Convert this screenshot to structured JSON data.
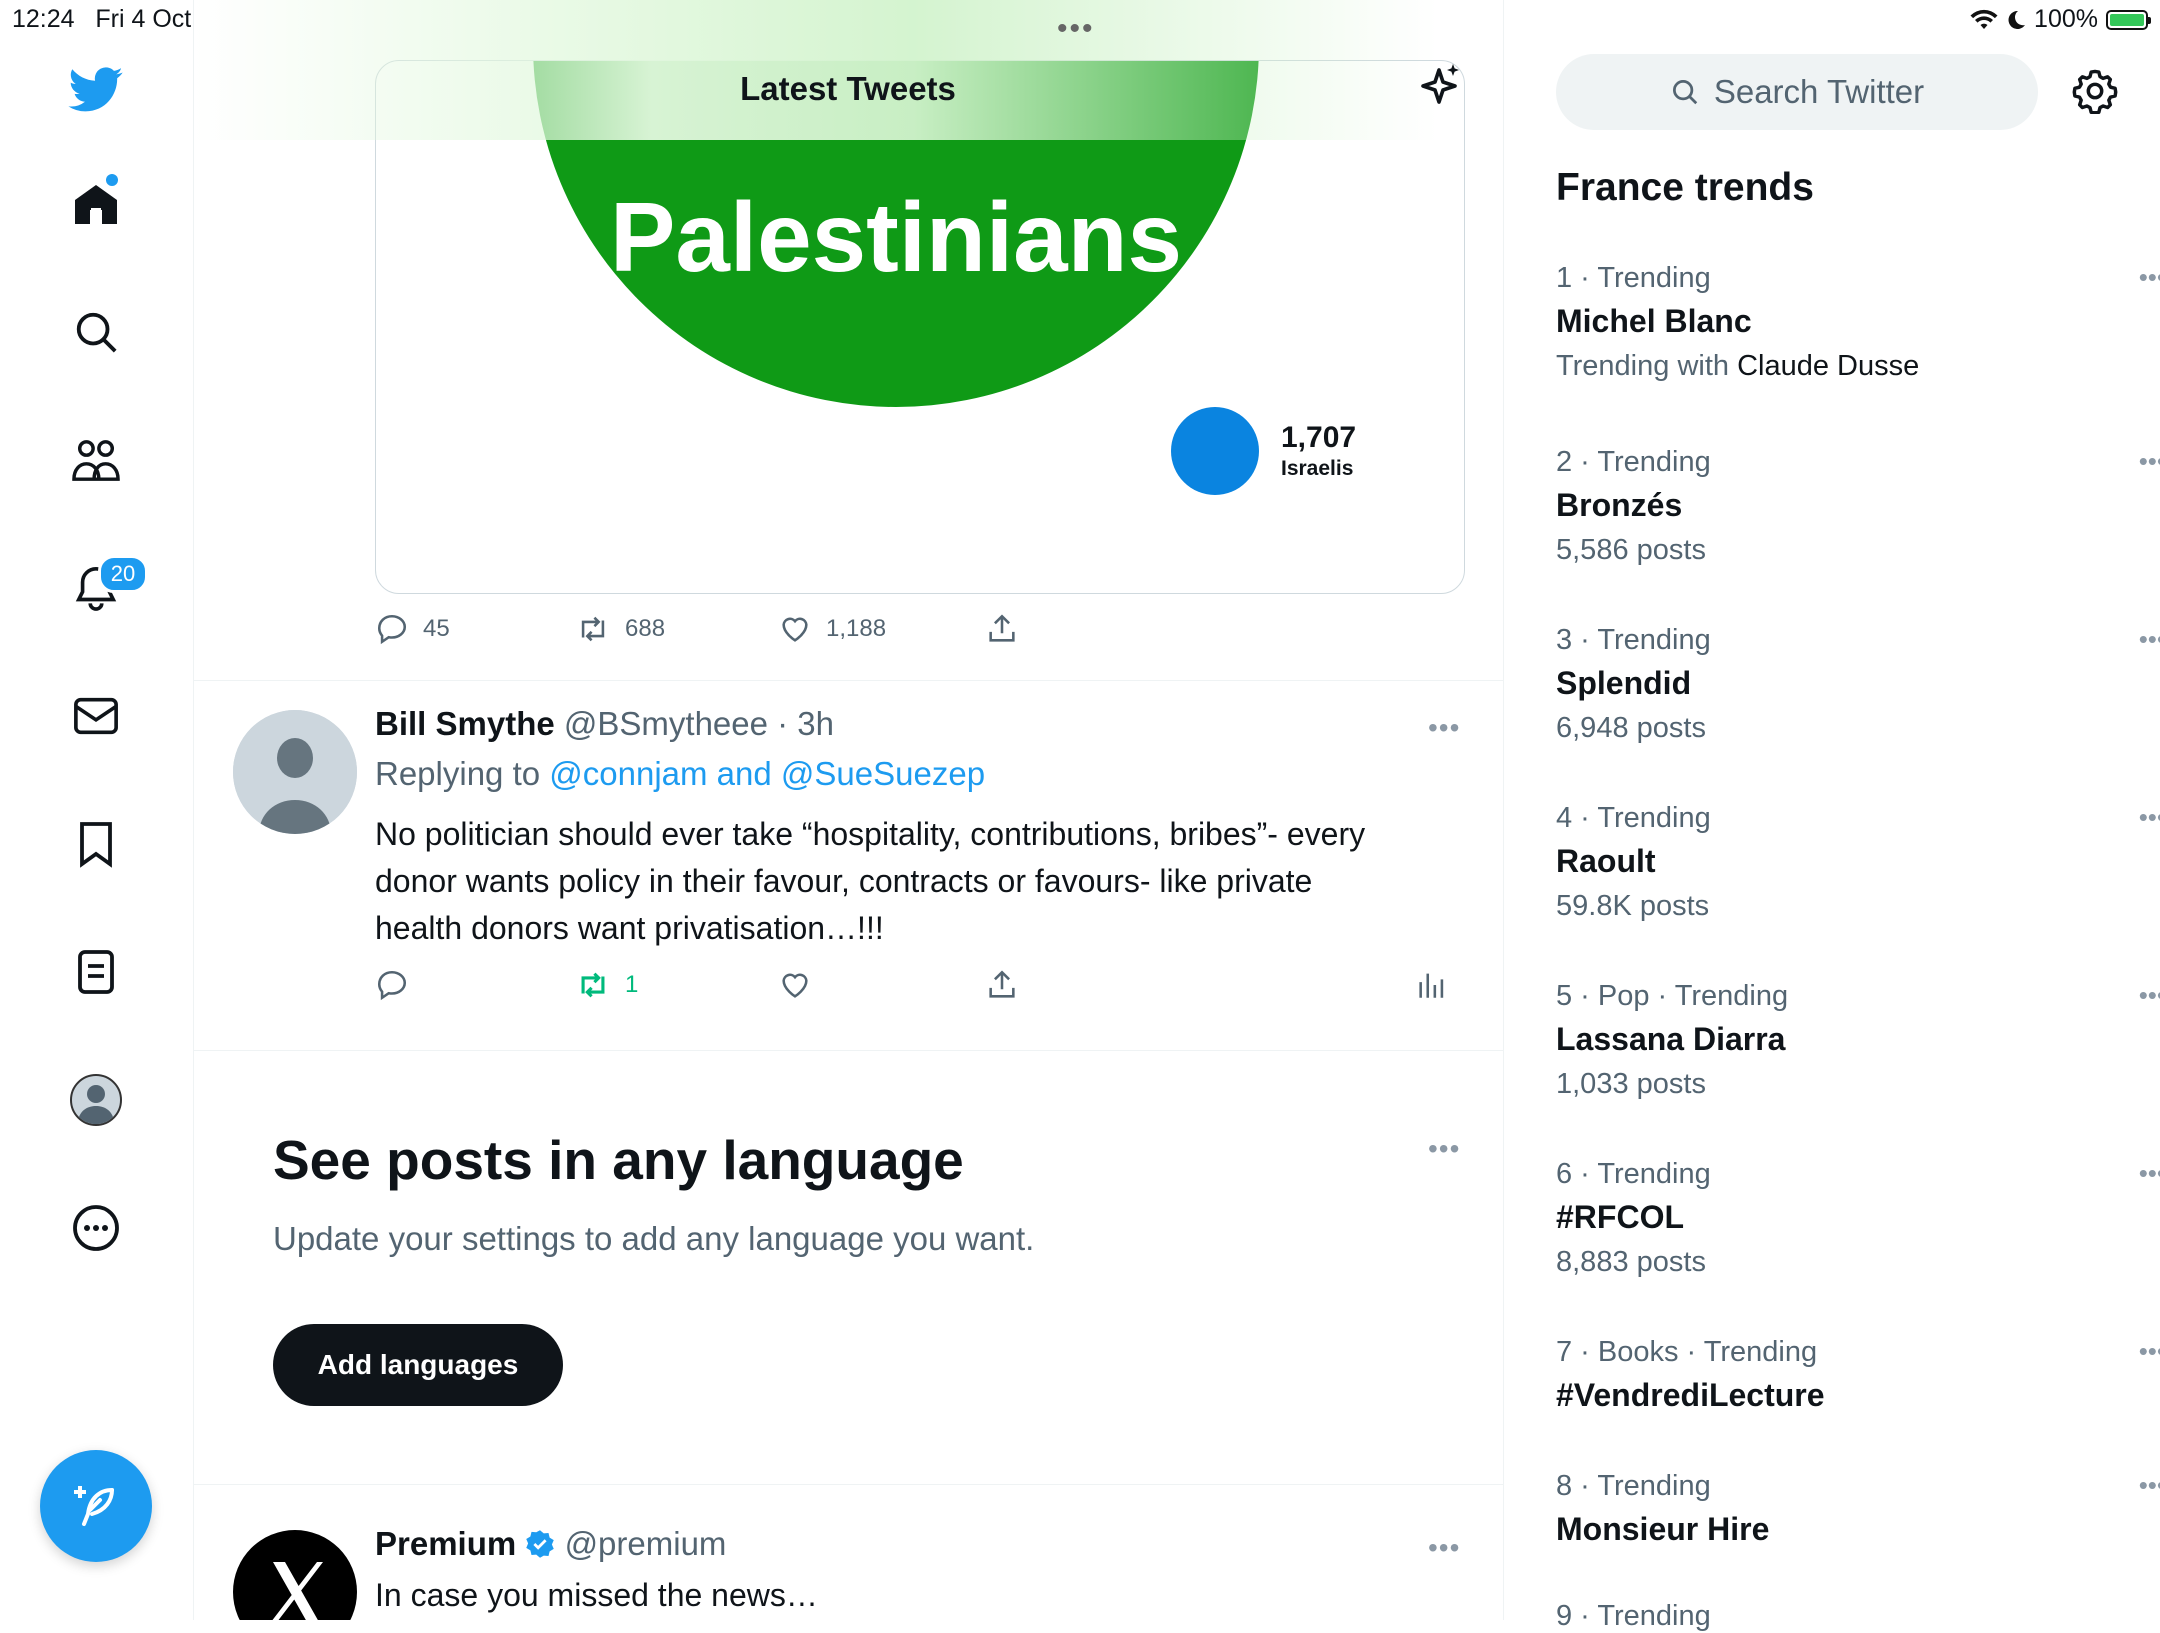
{
  "status_bar": {
    "time": "12:24",
    "date": "Fri 4 Oct",
    "battery": "100%",
    "battery_level": 1.0
  },
  "nav": {
    "items": [
      {
        "name": "home",
        "icon": "home-icon"
      },
      {
        "name": "explore",
        "icon": "search-icon"
      },
      {
        "name": "communities",
        "icon": "communities-icon"
      },
      {
        "name": "notifications",
        "icon": "bell-icon",
        "badge": "20"
      },
      {
        "name": "messages",
        "icon": "mail-icon"
      },
      {
        "name": "bookmarks",
        "icon": "bookmark-icon"
      },
      {
        "name": "lists",
        "icon": "list-icon"
      },
      {
        "name": "profile",
        "icon": "avatar-icon"
      },
      {
        "name": "more",
        "icon": "more-circle-icon"
      }
    ],
    "compose_icon": "compose-feather-icon",
    "accent": "#1d9bf0"
  },
  "header": {
    "title": "Latest Tweets",
    "top_dots": "•••"
  },
  "media": {
    "big_label": "Palestinians",
    "small_value": "1,707",
    "small_label": "Israelis",
    "big_color": "#0f9a16",
    "small_color": "#0a84e0"
  },
  "tweet1_actions": {
    "replies": "45",
    "retweets": "688",
    "likes": "1,188"
  },
  "tweet2": {
    "name": "Bill Smythe",
    "handle": "@BSmytheee · 3h",
    "replying_prefix": "Replying to",
    "replying_to": "@connjam and @SueSuezep",
    "text": "No politician should ever take “hospitality, contributions, bribes”- every donor wants policy in their favour, contracts or favours- like private health donors want privatisation…!!!",
    "retweets": "1",
    "retweet_color": "#00ba7c"
  },
  "language_prompt": {
    "title": "See posts in any language",
    "subtitle": "Update your settings to add any language you want.",
    "button": "Add languages"
  },
  "tweet3": {
    "name": "Premium",
    "handle": "@premium",
    "text": "In case you missed the news…"
  },
  "sidebar": {
    "search_placeholder": "Search Twitter",
    "trends_title": "France trends",
    "trends": [
      {
        "meta": "1 · Trending",
        "name": "Michel Blanc",
        "sub_prefix": "Trending with",
        "sub_strong": "Claude Dusse"
      },
      {
        "meta": "2 · Trending",
        "name": "Bronzés",
        "sub": "5,586 posts"
      },
      {
        "meta": "3 · Trending",
        "name": "Splendid",
        "sub": "6,948 posts"
      },
      {
        "meta": "4 · Trending",
        "name": "Raoult",
        "sub": "59.8K posts"
      },
      {
        "meta": "5 · Pop · Trending",
        "name": "Lassana Diarra",
        "sub": "1,033 posts"
      },
      {
        "meta": "6 · Trending",
        "name": "#RFCOL",
        "sub": "8,883 posts"
      },
      {
        "meta": "7 · Books · Trending",
        "name": "#VendrediLecture"
      },
      {
        "meta": "8 · Trending",
        "name": "Monsieur Hire"
      },
      {
        "meta": "9 · Trending"
      }
    ]
  }
}
